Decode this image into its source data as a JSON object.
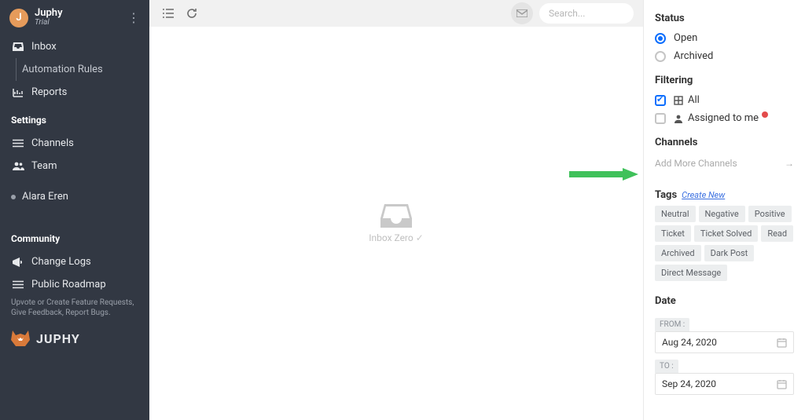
{
  "brand": {
    "name": "Juphy",
    "plan": "Trial",
    "avatar_letter": "J",
    "logo_text": "JUPHY"
  },
  "sidebar": {
    "inbox": "Inbox",
    "automation_rules": "Automation Rules",
    "reports": "Reports",
    "settings_title": "Settings",
    "channels": "Channels",
    "team": "Team",
    "user_name": "Alara Eren",
    "community_title": "Community",
    "change_logs": "Change Logs",
    "public_roadmap": "Public Roadmap",
    "roadmap_hint": "Upvote or Create Feature Requests, Give Feedback, Report Bugs."
  },
  "topbar": {
    "search_placeholder": "Search..."
  },
  "inbox": {
    "empty_text": "Inbox Zero"
  },
  "panel": {
    "status_title": "Status",
    "status_open": "Open",
    "status_archived": "Archived",
    "filtering_title": "Filtering",
    "filter_all": "All",
    "filter_assigned": "Assigned to me",
    "channels_title": "Channels",
    "add_channels": "Add More Channels",
    "tags_title": "Tags",
    "create_new": "Create New",
    "tags": [
      "Neutral",
      "Negative",
      "Positive",
      "Ticket",
      "Ticket Solved",
      "Read",
      "Archived",
      "Dark Post",
      "Direct Message"
    ],
    "date_title": "Date",
    "from_label": "FROM :",
    "to_label": "TO :",
    "from_value": "Aug 24, 2020",
    "to_value": "Sep 24, 2020"
  }
}
